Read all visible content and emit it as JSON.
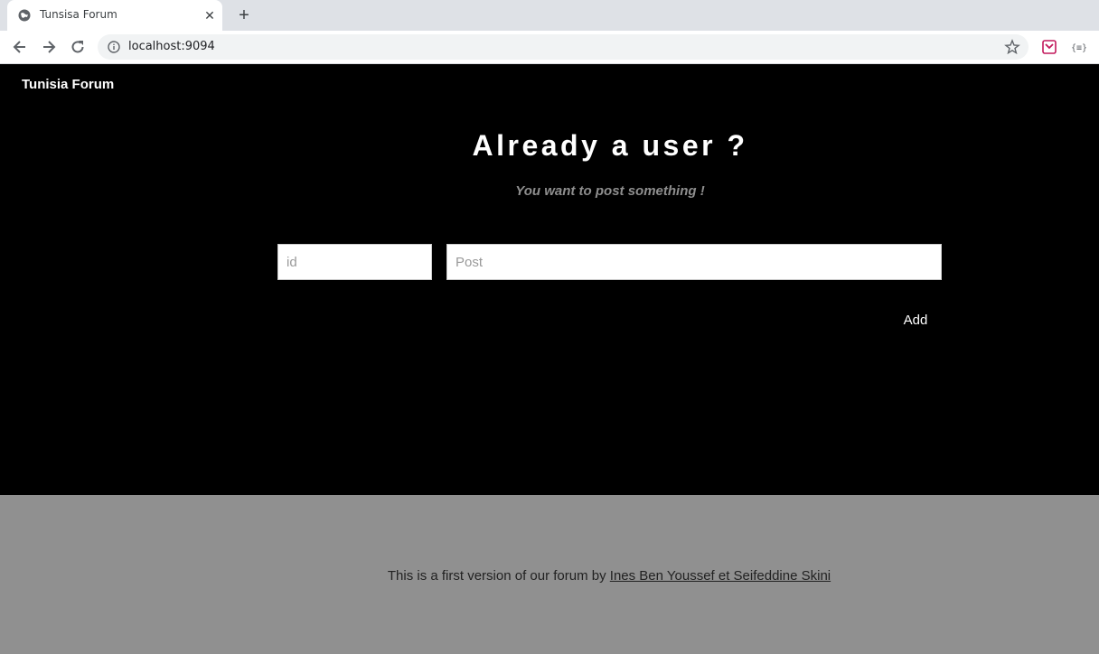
{
  "browser": {
    "tab_title": "Tunsisa Forum",
    "url": "localhost:9094",
    "icons": [
      "globe-icon",
      "close-icon",
      "plus-icon",
      "back-icon",
      "forward-icon",
      "reload-icon",
      "info-icon",
      "star-icon",
      "extension-icon"
    ]
  },
  "navbar": {
    "brand": "Tunisia Forum"
  },
  "main": {
    "heading": "Already a user ?",
    "subheading": "You want to post something !",
    "id_placeholder": "id",
    "post_placeholder": "Post",
    "add_label": "Add"
  },
  "footer": {
    "text": "This is a first version of our forum by ",
    "link_text": "Ines Ben Youssef et Seifeddine Skini"
  },
  "colors": {
    "page_bg": "#000000",
    "footer_bg": "#909090",
    "subheading": "#8e8e8e"
  }
}
